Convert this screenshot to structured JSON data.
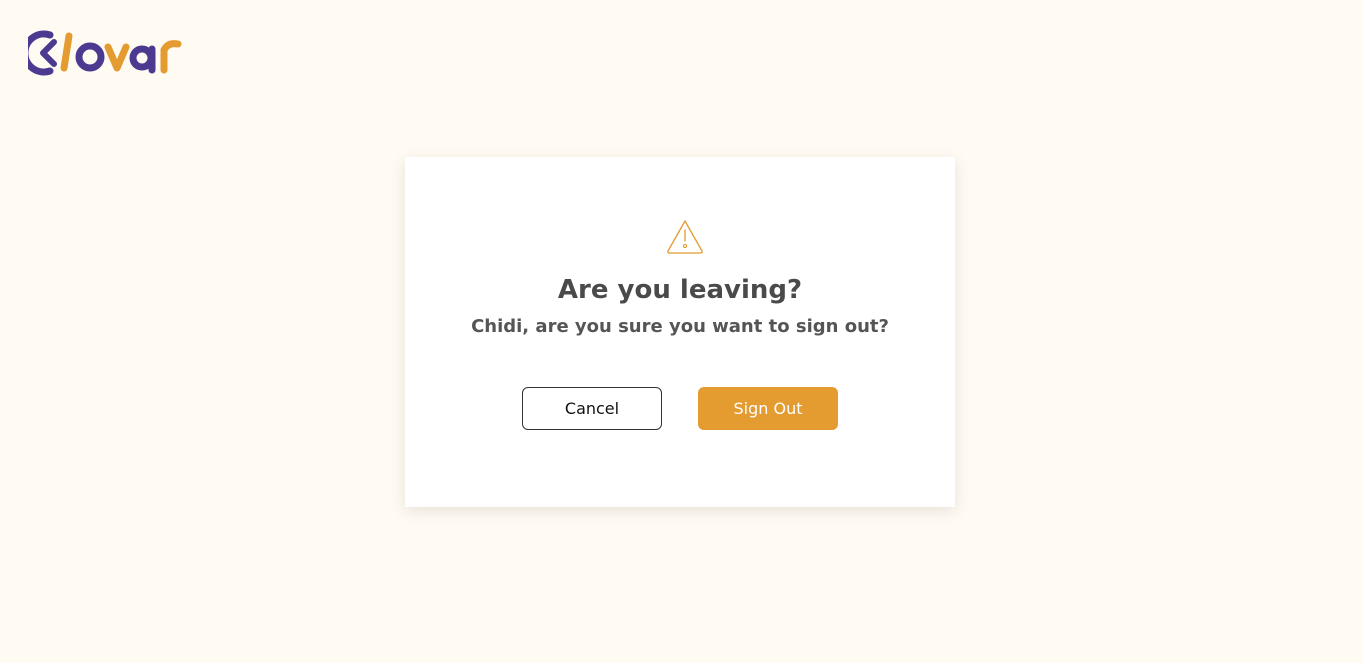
{
  "brand": {
    "name": "Clovar",
    "primary_color": "#4b3a8f",
    "accent_color": "#e49b2f"
  },
  "dialog": {
    "icon": "warning-triangle-icon",
    "title": "Are you leaving?",
    "message": "Chidi, are you sure you want to sign out?",
    "cancel_label": "Cancel",
    "confirm_label": "Sign Out"
  }
}
